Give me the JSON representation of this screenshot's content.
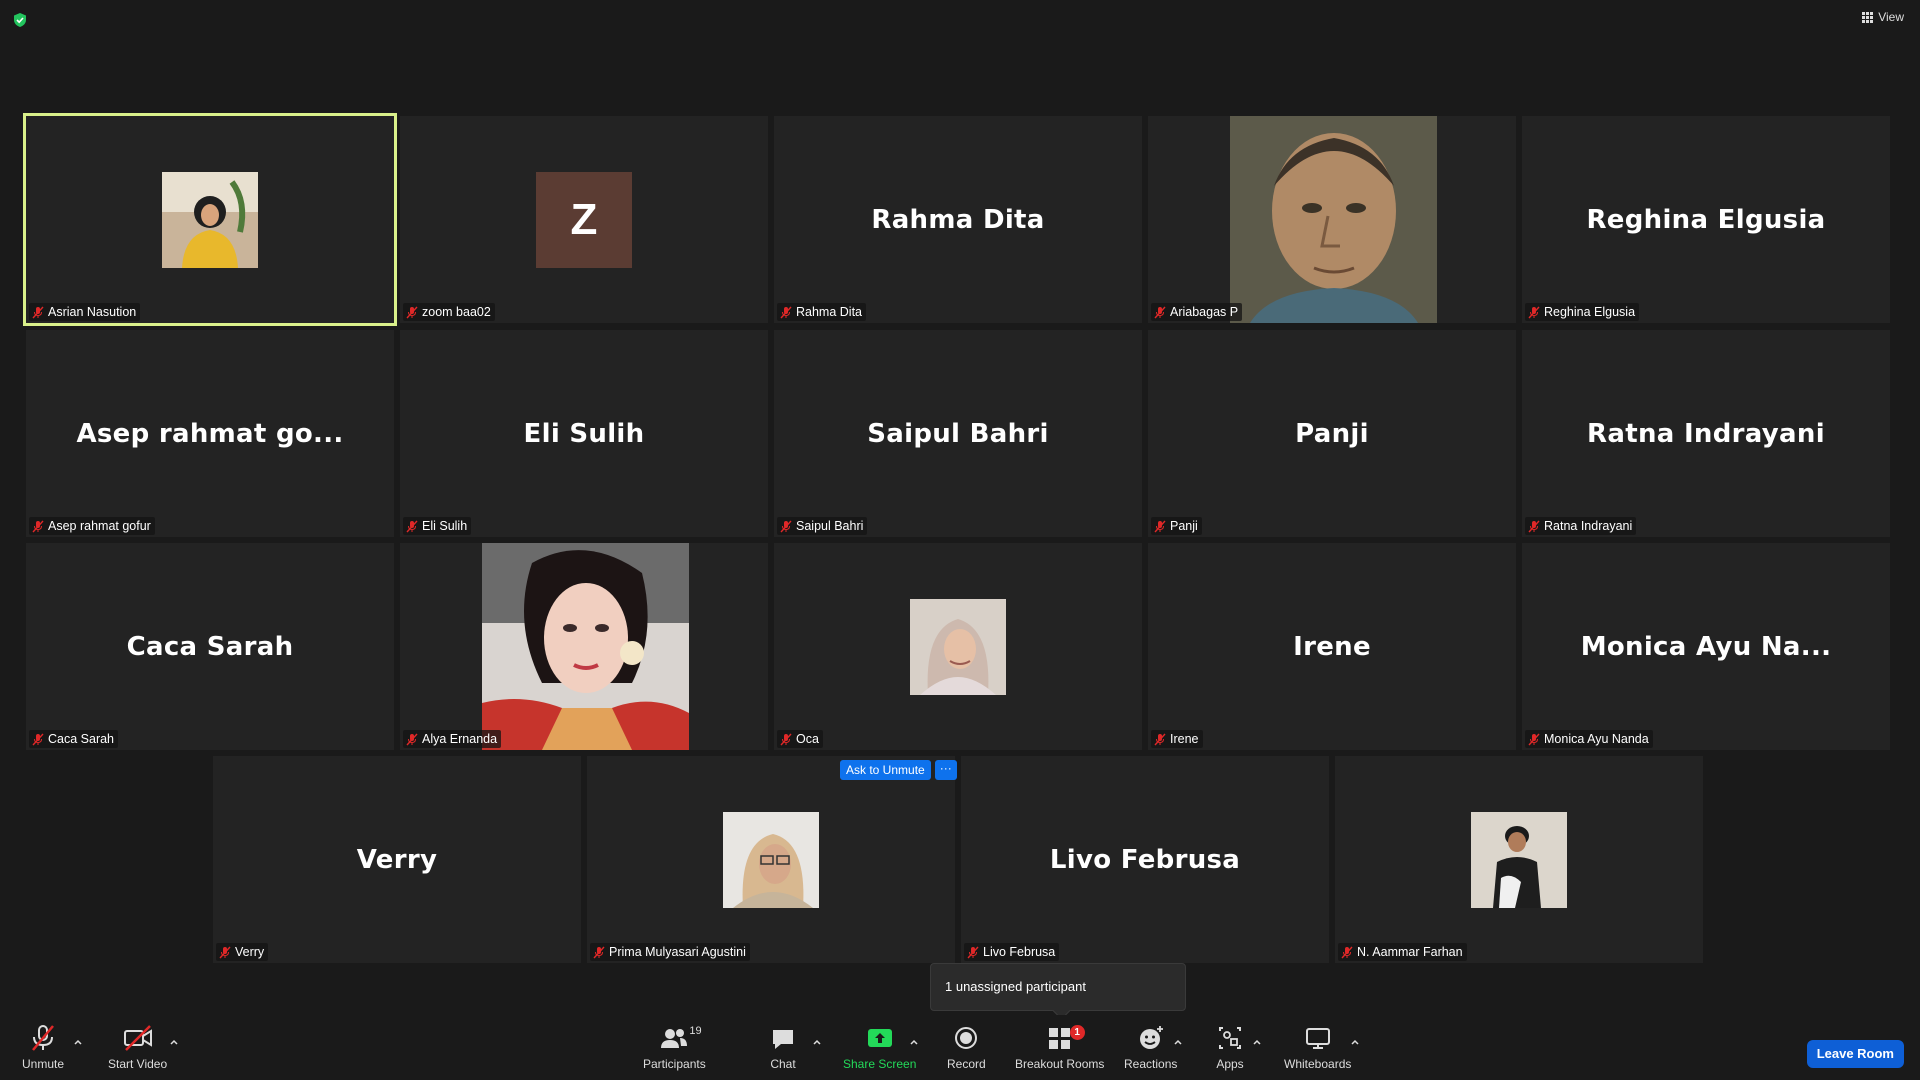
{
  "topbar": {
    "view_label": "View"
  },
  "tiles": [
    {
      "name": "Asrian Nasution",
      "big": "",
      "mode": "photo"
    },
    {
      "name": "zoom baa02",
      "big": "",
      "mode": "letter",
      "letter": "Z"
    },
    {
      "name": "Rahma Dita",
      "big": "Rahma Dita",
      "mode": "name"
    },
    {
      "name": "Ariabagas P",
      "big": "",
      "mode": "bigphoto"
    },
    {
      "name": "Reghina Elgusia",
      "big": "Reghina Elgusia",
      "mode": "name"
    },
    {
      "name": "Asep rahmat gofur",
      "big": "Asep  rahmat  go...",
      "mode": "name"
    },
    {
      "name": "Eli Sulih",
      "big": "Eli Sulih",
      "mode": "name"
    },
    {
      "name": "Saipul Bahri",
      "big": "Saipul Bahri",
      "mode": "name"
    },
    {
      "name": "Panji",
      "big": "Panji",
      "mode": "name"
    },
    {
      "name": "Ratna Indrayani",
      "big": "Ratna Indrayani",
      "mode": "name"
    },
    {
      "name": "Caca Sarah",
      "big": "Caca Sarah",
      "mode": "name"
    },
    {
      "name": "Alya Ernanda",
      "big": "",
      "mode": "bigphoto"
    },
    {
      "name": "Oca",
      "big": "",
      "mode": "photo"
    },
    {
      "name": "Irene",
      "big": "Irene",
      "mode": "name"
    },
    {
      "name": "Monica Ayu Nanda",
      "big": "Monica  Ayu  Na...",
      "mode": "name"
    },
    {
      "name": "Verry",
      "big": "Verry",
      "mode": "name"
    },
    {
      "name": "Prima Mulyasari Agustini",
      "big": "",
      "mode": "photo"
    },
    {
      "name": "Livo Februsa",
      "big": "Livo Februsa",
      "mode": "name"
    },
    {
      "name": "N. Aammar Farhan",
      "big": "",
      "mode": "photo"
    }
  ],
  "hover_actions": {
    "ask_to_unmute": "Ask to Unmute",
    "more": "···"
  },
  "tooltip": {
    "text": "1 unassigned participant"
  },
  "toolbar": {
    "unmute": "Unmute",
    "start_video": "Start Video",
    "participants": "Participants",
    "participants_count": "19",
    "chat": "Chat",
    "share_screen": "Share Screen",
    "record": "Record",
    "breakout_rooms": "Breakout Rooms",
    "breakout_badge": "1",
    "reactions": "Reactions",
    "apps": "Apps",
    "whiteboards": "Whiteboards",
    "leave_room": "Leave Room"
  },
  "colors": {
    "active_speaker_border": "#d9f08a",
    "accent_blue": "#0e72ed",
    "share_green": "#23d959",
    "mute_red": "#e02828"
  }
}
